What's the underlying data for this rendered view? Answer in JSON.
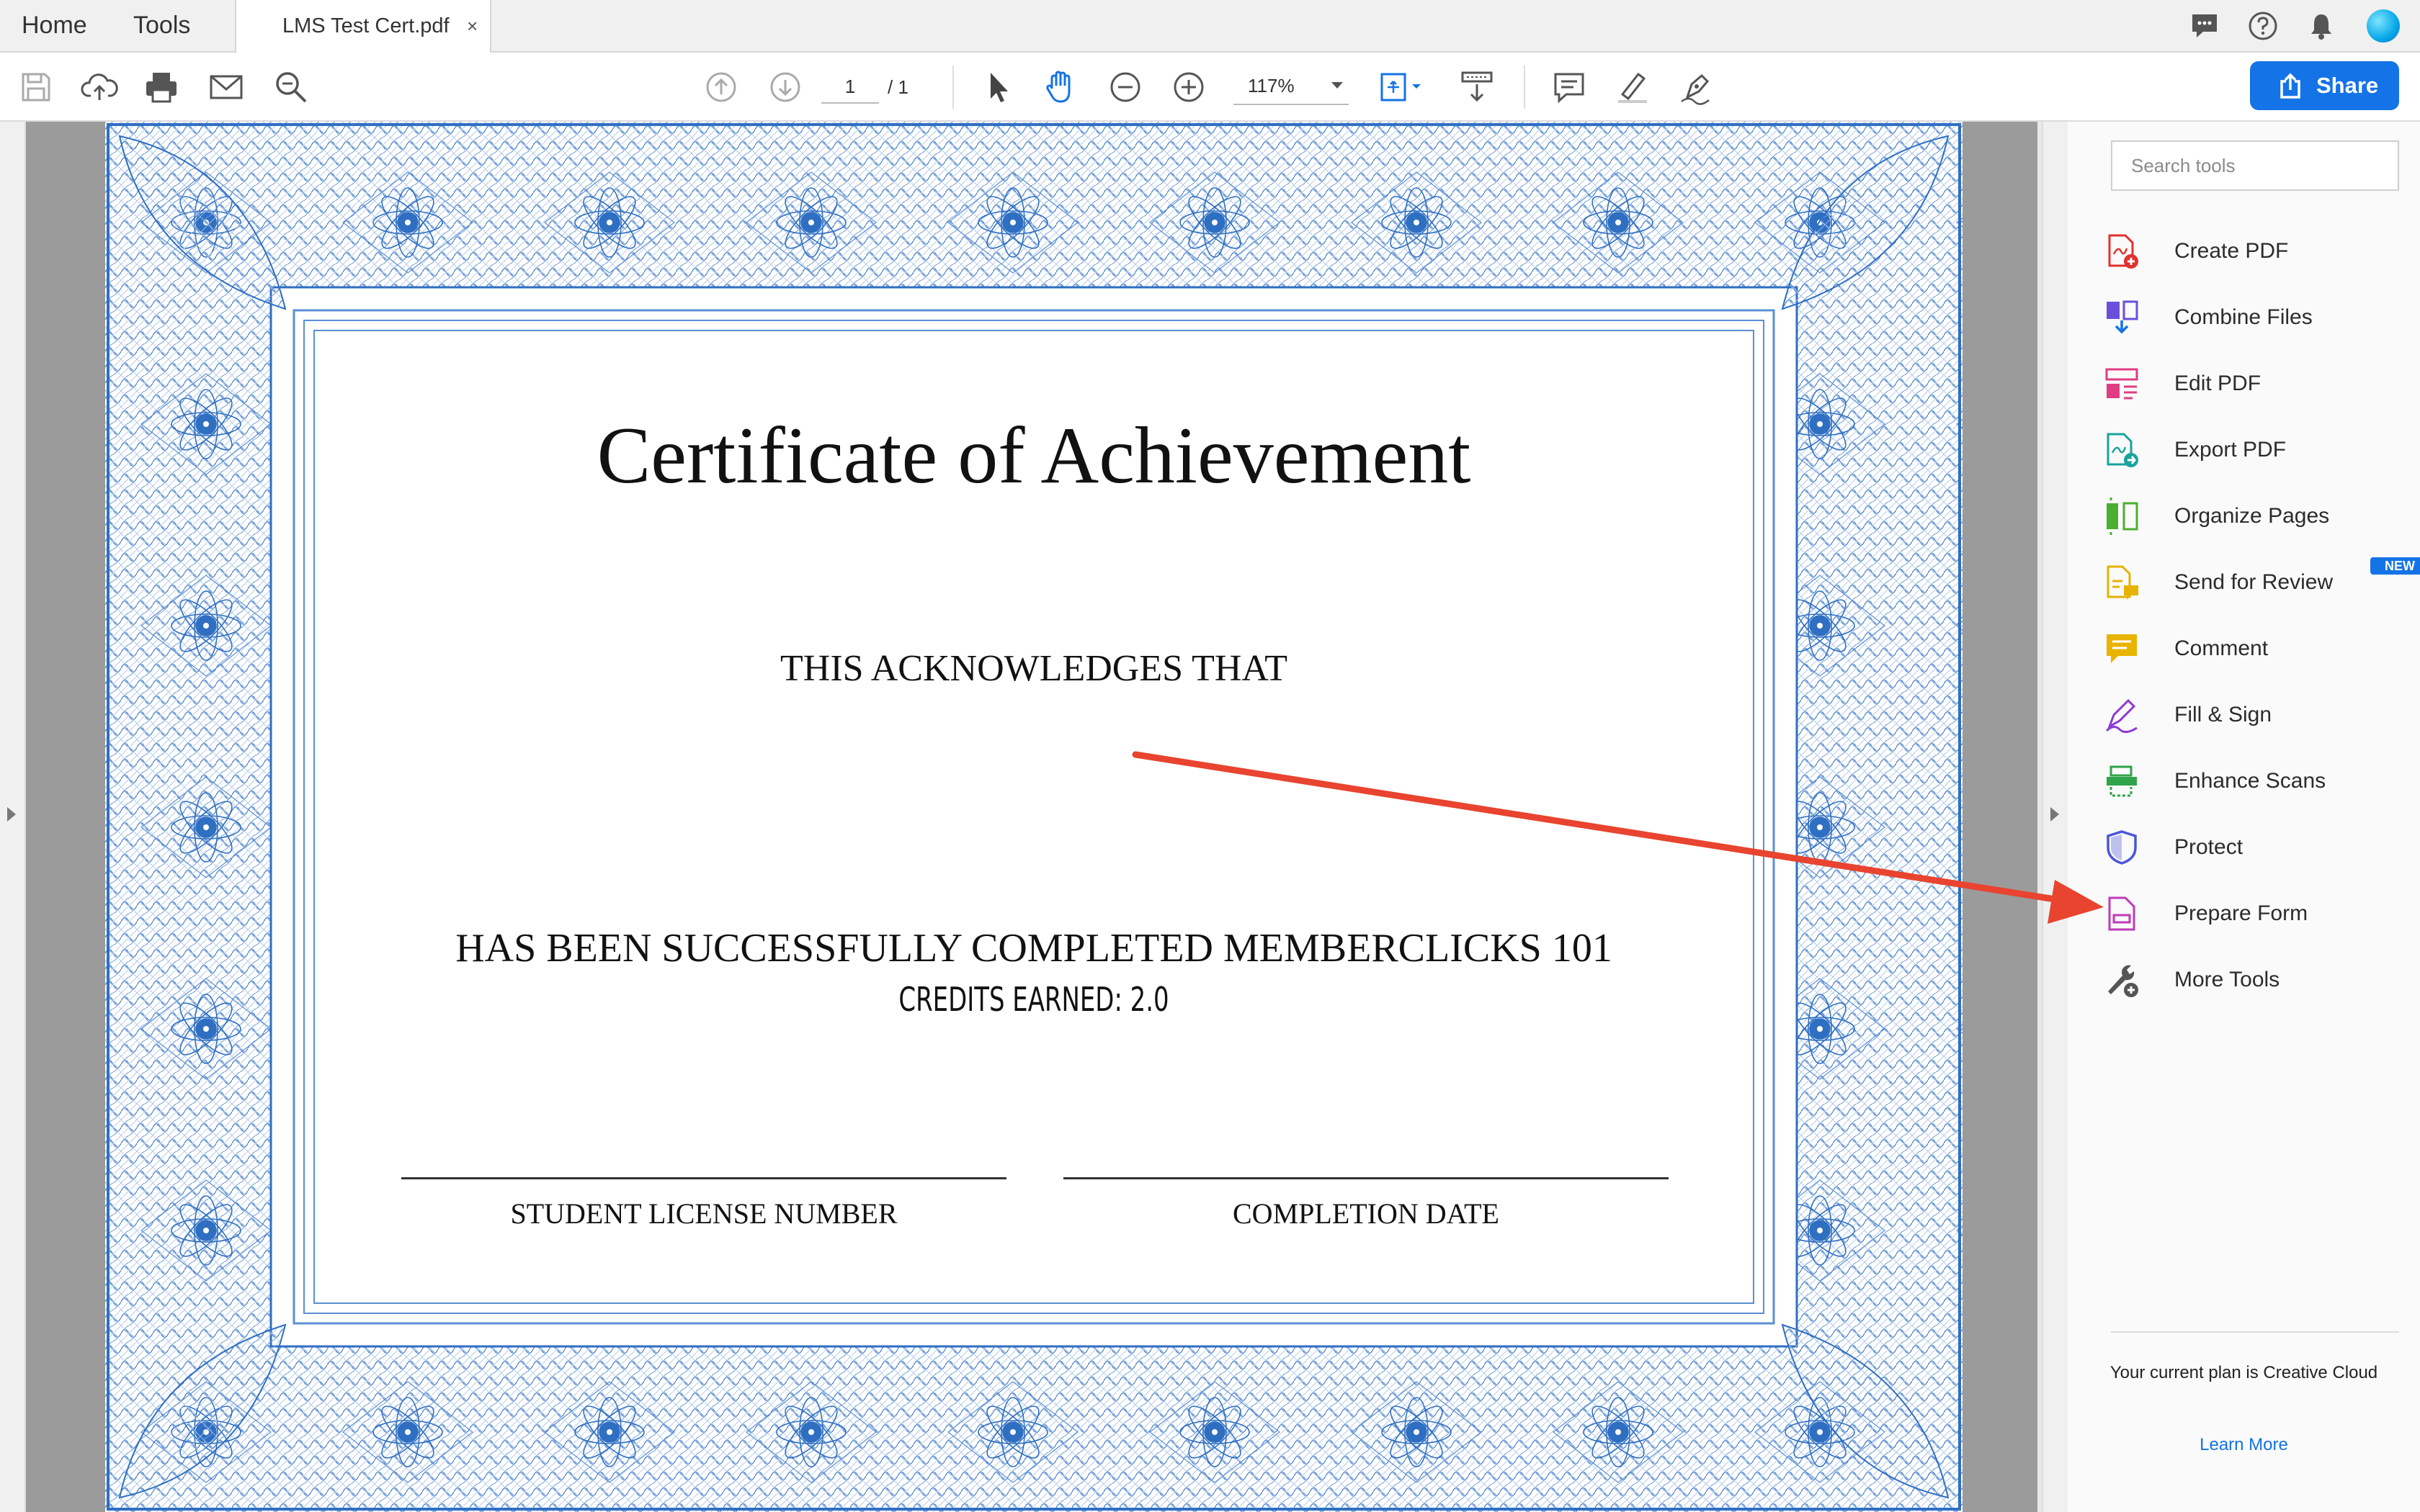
{
  "tabs": {
    "home": "Home",
    "tools": "Tools"
  },
  "document_tab": {
    "title": "LMS Test Cert.pdf",
    "close": "×"
  },
  "top_icons": [
    "chat-icon",
    "help-icon",
    "bell-icon",
    "avatar"
  ],
  "toolbar": {
    "page_current": "1",
    "page_total": "/ 1",
    "zoom": "117%",
    "share_label": "Share"
  },
  "certificate": {
    "title": "Certificate of Achievement",
    "acknowledges": "THIS ACKNOWLEDGES THAT",
    "completed": "HAS BEEN SUCCESSFULLY COMPLETED MEMBERCLICKS 101",
    "credits": "CREDITS EARNED: 2.0",
    "signature_labels": [
      "STUDENT LICENSE NUMBER",
      "COMPLETION DATE"
    ]
  },
  "tools_pane": {
    "search_placeholder": "Search tools",
    "items": [
      {
        "label": "Create PDF",
        "icon": "create-pdf-icon",
        "color": "#e0312d"
      },
      {
        "label": "Combine Files",
        "icon": "combine-files-icon",
        "color": "#6b4fdc"
      },
      {
        "label": "Edit PDF",
        "icon": "edit-pdf-icon",
        "color": "#e03d84"
      },
      {
        "label": "Export PDF",
        "icon": "export-pdf-icon",
        "color": "#1aa39c"
      },
      {
        "label": "Organize Pages",
        "icon": "organize-pages-icon",
        "color": "#4caf2f"
      },
      {
        "label": "Send for Review",
        "icon": "send-for-review-icon",
        "color": "#e5b300"
      },
      {
        "label": "Comment",
        "icon": "comment-icon",
        "color": "#e8b400"
      },
      {
        "label": "Fill & Sign",
        "icon": "fill-sign-icon",
        "color": "#8e3ad6"
      },
      {
        "label": "Enhance Scans",
        "icon": "enhance-scans-icon",
        "color": "#2fa44a"
      },
      {
        "label": "Protect",
        "icon": "protect-icon",
        "color": "#4b57d6"
      },
      {
        "label": "Prepare Form",
        "icon": "prepare-form-icon",
        "color": "#c03ab8"
      },
      {
        "label": "More Tools",
        "icon": "more-tools-icon",
        "color": "#555555"
      }
    ],
    "new_badge": "NEW",
    "plan_text": "Your current plan is Creative Cloud",
    "learn_more": "Learn More"
  },
  "colors": {
    "accent": "#1473e6",
    "border_blue": "#2f6fc2",
    "annotation_arrow": "#e8442f"
  }
}
